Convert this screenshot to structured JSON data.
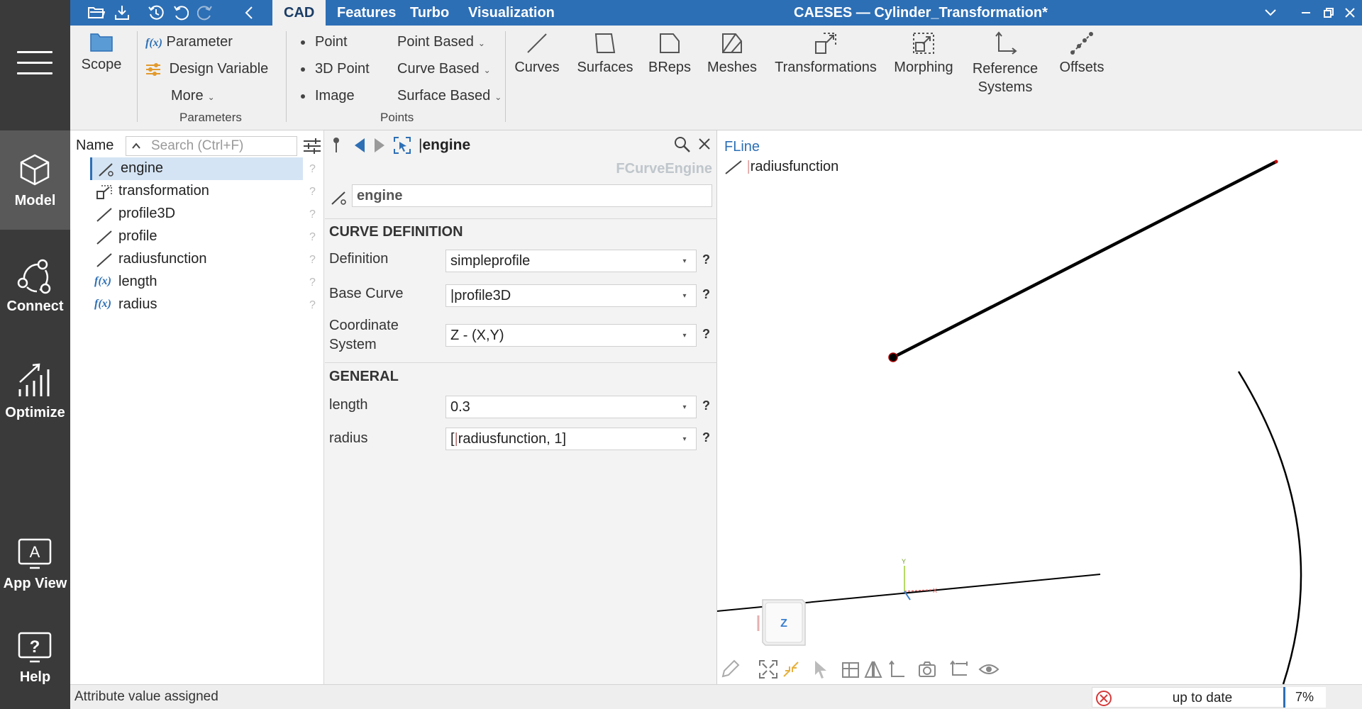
{
  "app": {
    "title": "CAESES — Cylinder_Transformation*",
    "tabs": [
      "CAD",
      "Features",
      "Turbo",
      "Visualization"
    ],
    "active_tab": "CAD",
    "accent_color": "#2d6fb5"
  },
  "rail": {
    "items": [
      {
        "label": "Model",
        "icon": "cube-icon",
        "active": true
      },
      {
        "label": "Connect",
        "icon": "connect-icon",
        "active": false
      },
      {
        "label": "Optimize",
        "icon": "chart-icon",
        "active": false
      },
      {
        "label": "App View",
        "icon": "app-icon",
        "active": false
      },
      {
        "label": "Help",
        "icon": "help-icon",
        "active": false
      }
    ]
  },
  "ribbon": {
    "scope_label": "Scope",
    "parameter_label": "Parameter",
    "design_variable_label": "Design Variable",
    "more_label": "More",
    "parameters_group": "Parameters",
    "point_label": "Point",
    "point3d_label": "3D Point",
    "image_label": "Image",
    "point_based_label": "Point Based",
    "curve_based_label": "Curve Based",
    "surface_based_label": "Surface Based",
    "points_group": "Points",
    "curves_label": "Curves",
    "surfaces_label": "Surfaces",
    "breps_label": "BReps",
    "meshes_label": "Meshes",
    "transformations_label": "Transformations",
    "morphing_label": "Morphing",
    "reference_label_1": "Reference",
    "reference_label_2": "Systems",
    "offsets_label": "Offsets"
  },
  "tree": {
    "name_header": "Name",
    "search_placeholder": "Search (Ctrl+F)",
    "items": [
      {
        "label": "engine",
        "icon": "curve-engine-icon",
        "selected": true
      },
      {
        "label": "transformation",
        "icon": "transformation-icon",
        "selected": false
      },
      {
        "label": "profile3D",
        "icon": "line-icon",
        "selected": false
      },
      {
        "label": "profile",
        "icon": "line-icon",
        "selected": false
      },
      {
        "label": "radiusfunction",
        "icon": "line-icon",
        "selected": false
      },
      {
        "label": "length",
        "icon": "fx-icon",
        "selected": false
      },
      {
        "label": "radius",
        "icon": "fx-icon",
        "selected": false
      }
    ],
    "help_mark": "?"
  },
  "props": {
    "title_bar": "|",
    "title": "engine",
    "type": "FCurveEngine",
    "name_value": "engine",
    "section_curve": "CURVE DEFINITION",
    "definition_label": "Definition",
    "definition_value": "simpleprofile",
    "base_curve_label": "Base Curve",
    "base_curve_value": "profile3D",
    "coord_label_1": "Coordinate",
    "coord_label_2": "System",
    "coord_value": "Z - (X,Y)",
    "section_general": "GENERAL",
    "length_label": "length",
    "length_value": "0.3",
    "radius_label": "radius",
    "radius_value_pre": "[",
    "radius_value": "radiusfunction, 1]",
    "help_mark": "?",
    "bar": "|"
  },
  "viewport": {
    "type_label": "FLine",
    "item_label": "radiusfunction",
    "item_bar": "|",
    "cube_face": "Z",
    "axis_y": "Y",
    "axis_x": "X"
  },
  "status": {
    "message": "Attribute value assigned",
    "state": "up to date",
    "percent": "7%",
    "error_color": "#d43a3a"
  }
}
